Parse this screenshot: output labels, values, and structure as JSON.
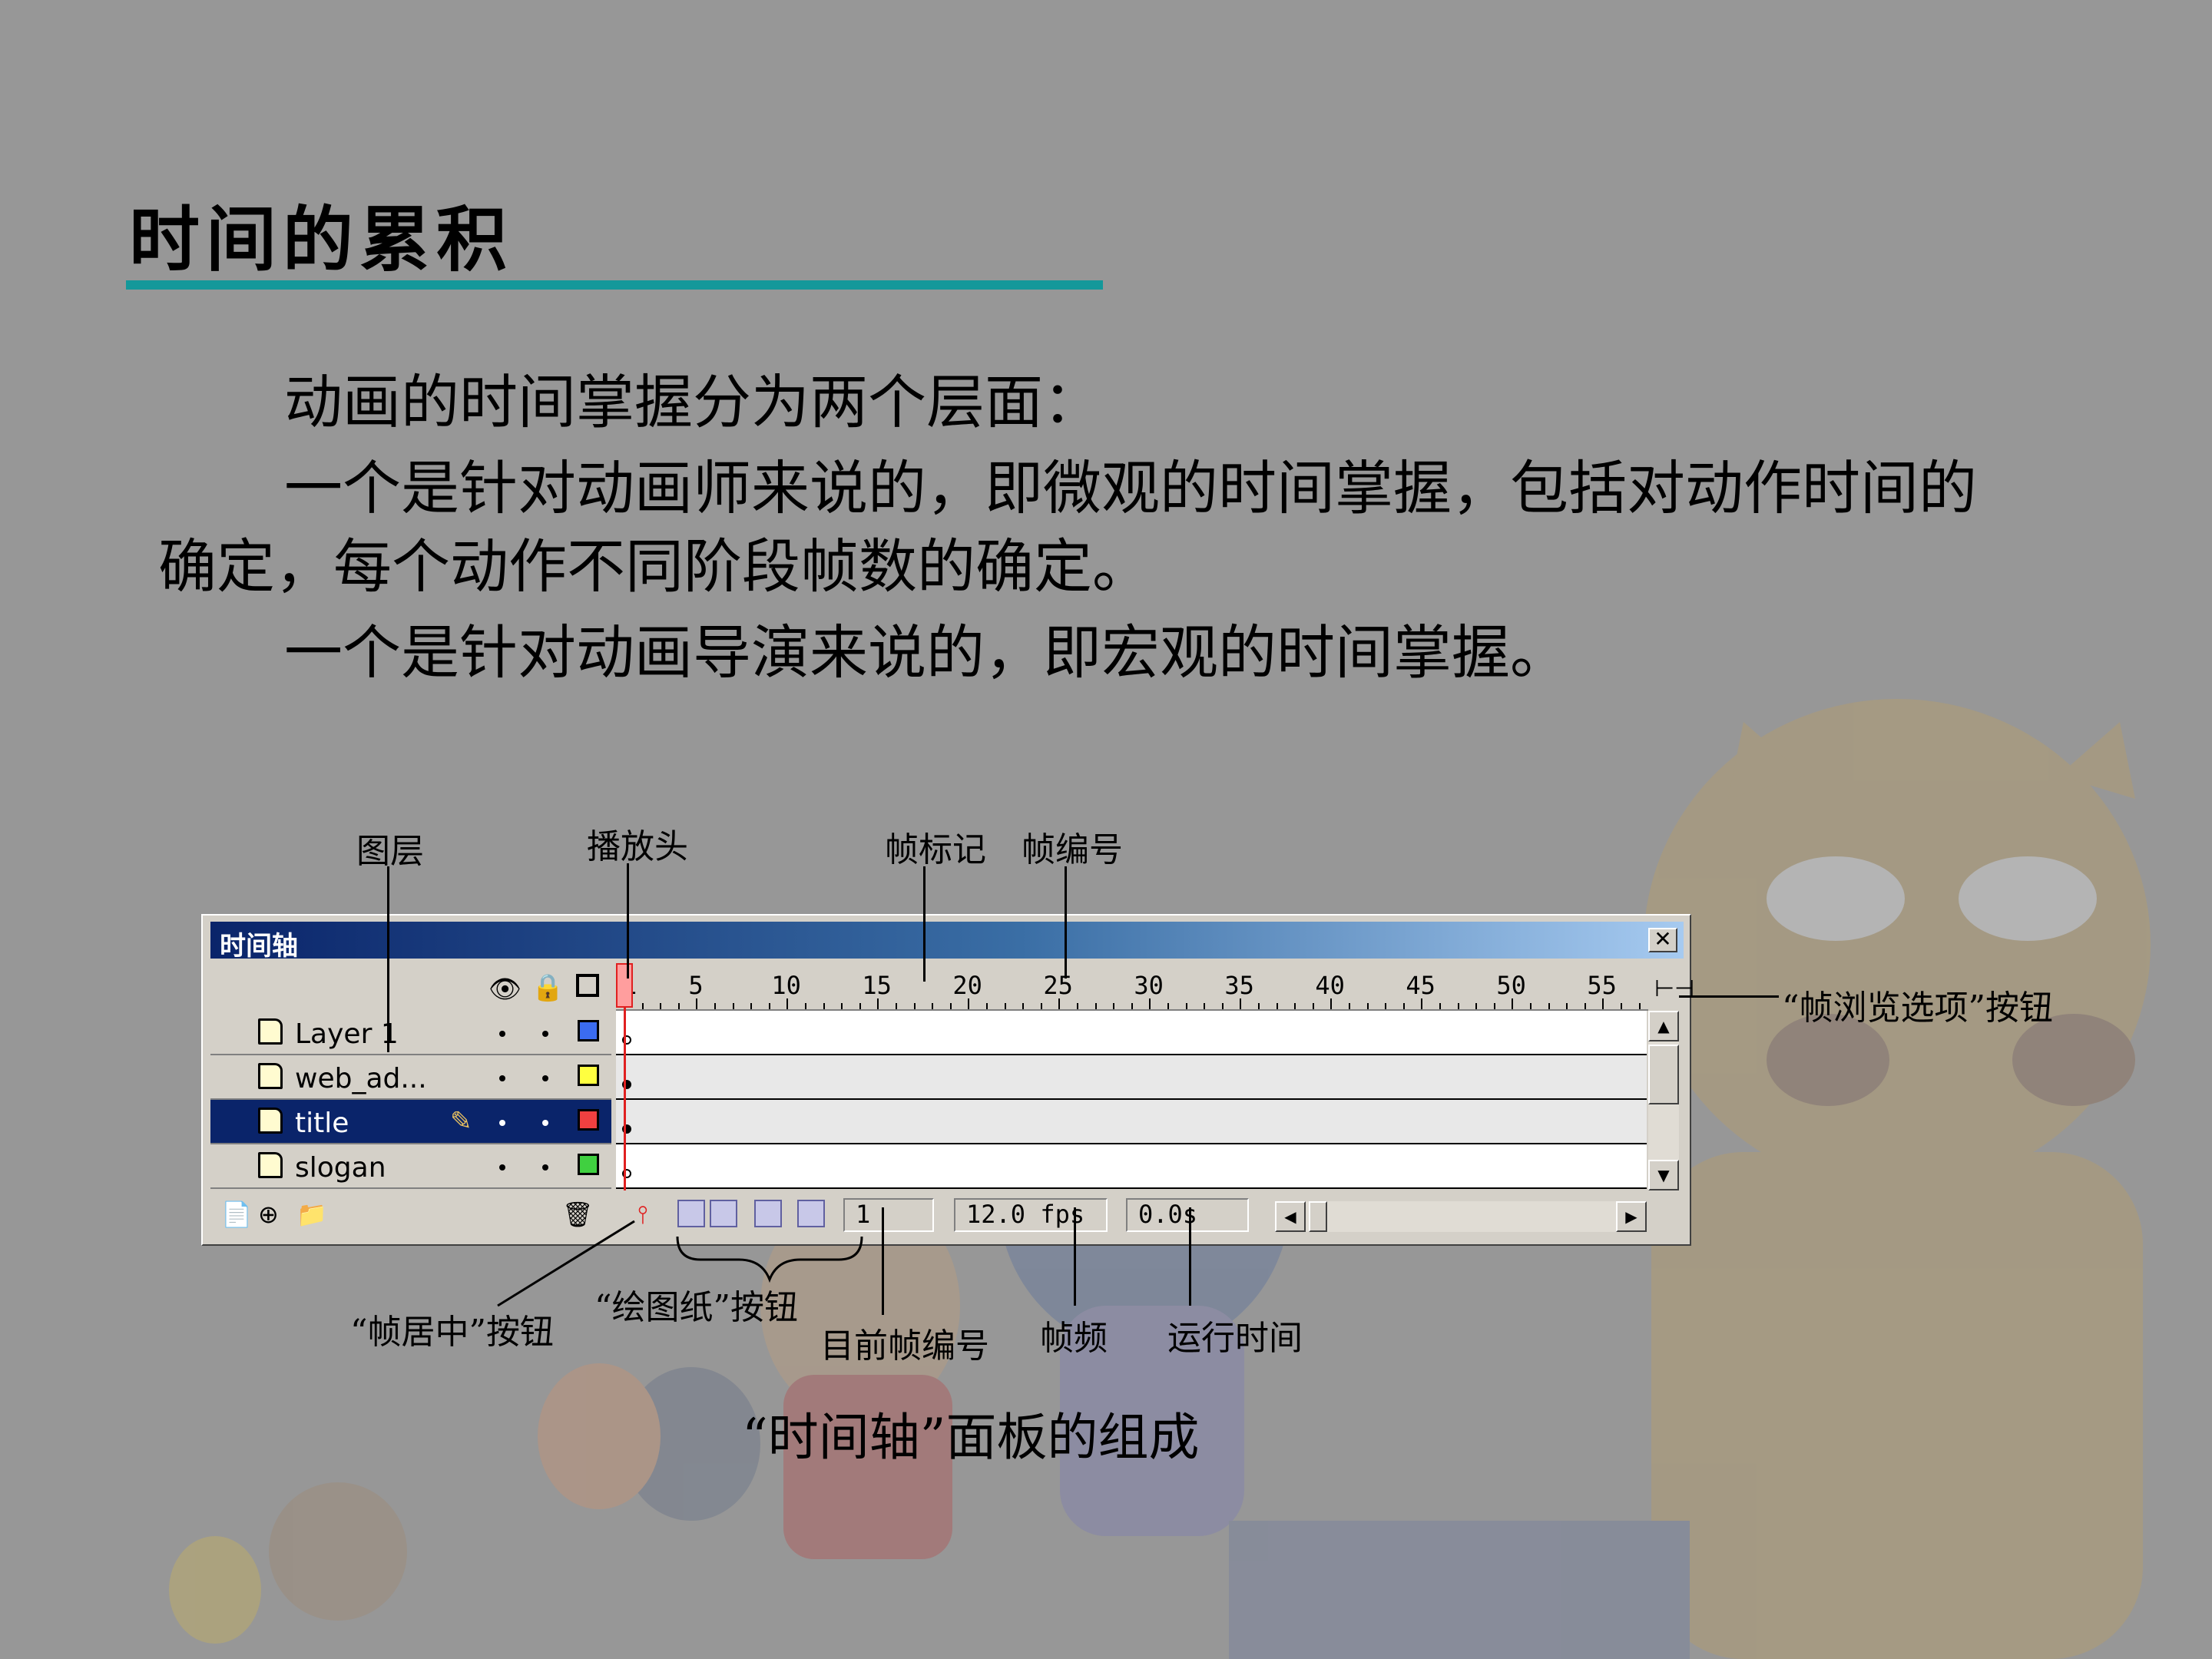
{
  "slide": {
    "title": "时间的累积",
    "paragraphs": [
      "动画的时间掌握分为两个层面：",
      "一个是针对动画师来说的，即微观的时间掌握，包括对动作时间的",
      "确定，每个动作不同阶段帧数的确定。",
      "一个是针对动画导演来说的，即宏观的时间掌握。"
    ],
    "caption": "“时间轴”面板的组成"
  },
  "callouts": {
    "layers": "图层",
    "playhead": "播放头",
    "frame_label": "帧标记",
    "frame_number": "帧编号",
    "frame_view_options": "“帧浏览选项”按钮",
    "center_frame": "“帧居中”按钮",
    "onion_skin": "“绘图纸”按钮",
    "current_frame": "目前帧编号",
    "frame_rate": "帧频",
    "elapsed_time": "运行时间"
  },
  "timeline": {
    "panel_title": "时间轴",
    "close_glyph": "✕",
    "ruler_numbers": [
      "1",
      "5",
      "10",
      "15",
      "20",
      "25",
      "30",
      "35",
      "40",
      "45",
      "50",
      "55"
    ],
    "layers": [
      {
        "name": "Layer 1",
        "color": "#3b6cf0",
        "selected": false
      },
      {
        "name": "web_ad...",
        "color": "#ffff40",
        "selected": false
      },
      {
        "name": "title",
        "color": "#f04040",
        "selected": true
      },
      {
        "name": "slogan",
        "color": "#40d040",
        "selected": false
      }
    ],
    "current_frame": "1",
    "frame_rate": "12.0 fps",
    "elapsed_time": "0.0s",
    "icons": {
      "eye": "eye-icon",
      "lock": "lock-icon",
      "outline": "outline-icon",
      "trash": "trash-icon",
      "add_layer": "add-layer-icon",
      "add_guide": "add-guide-layer-icon",
      "add_folder": "add-folder-icon",
      "pencil": "pencil-icon",
      "frame_view": "frame-view-icon"
    },
    "colors": {
      "titlebar": "#0a246a",
      "selected_row": "#0a246a",
      "playhead": "#e02020"
    }
  }
}
